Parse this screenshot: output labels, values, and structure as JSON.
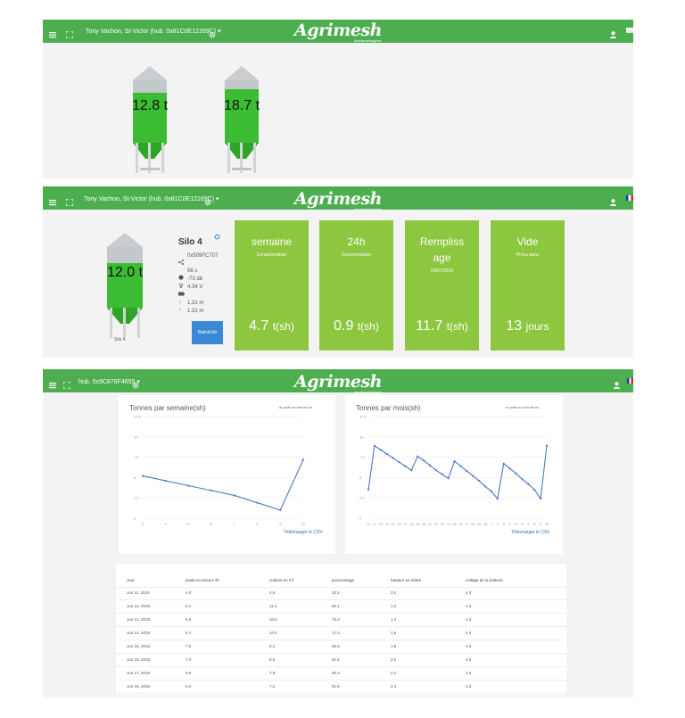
{
  "brand": {
    "logo": "Agrimesh",
    "tagline": "technologies"
  },
  "colors": {
    "green_bar": "#4cae4f",
    "card_green": "#8dc63f",
    "silo_fill": "#3cbc32",
    "button_blue": "#3b88d6"
  },
  "panel1": {
    "user": "Tony Vachon, St-Victor (hub. 0x81C0E12169C) ▾",
    "silos": [
      {
        "label": "12.8 t"
      },
      {
        "label": "18.7 t"
      }
    ]
  },
  "panel2": {
    "user": "Tony Vachon, St-Victor (hub. 0x81C0E12169C) ▾",
    "silo_value": "12.0 t",
    "silo_caption": "Silo 4",
    "silo_name": "Silo 4",
    "device_id": "0x509FC707",
    "stats": [
      "56 s",
      "-73 db",
      "4.34 V"
    ],
    "heights": [
      "1.31 m",
      "1.31 m"
    ],
    "refresh_button": "Rafraîchir",
    "cards": [
      {
        "title": "semaine",
        "subtitle": "Consommation",
        "value": "4.7",
        "unit": "t(sh)"
      },
      {
        "title": "24h",
        "subtitle": "Consommation",
        "value": "0.9",
        "unit": "t(sh)"
      },
      {
        "title": "Rempliss age",
        "subtitle": "09/07/2019",
        "value": "11.7",
        "unit": "t(sh)"
      },
      {
        "title": "Vide",
        "subtitle": "Prévu dans",
        "value": "13",
        "unit": "jours"
      }
    ]
  },
  "panel3": {
    "hub": "hub. 0x9C876F4655 ▾",
    "csv_link": "Télécharger le CSV",
    "table": {
      "headers": [
        "Jour",
        "poids en tonnes sh",
        "volume en m³",
        "pourcentage",
        "hauteur en mètre",
        "voltage de la batterie"
      ],
      "rows": [
        [
          "Jun 11, 2019",
          "4.0",
          "4.6",
          "32.2",
          "3.2",
          "4.3"
        ],
        [
          "Jun 12, 2019",
          "9.1",
          "11.2",
          "80.1",
          "1.2",
          "4.3"
        ],
        [
          "Jun 13, 2019",
          "8.6",
          "10.6",
          "75.3",
          "1.4",
          "4.3"
        ],
        [
          "Jun 14, 2019",
          "8.1",
          "10.0",
          "71.0",
          "1.6",
          "4.3"
        ],
        [
          "Jun 15, 2019",
          "7.5",
          "9.2",
          "65.5",
          "1.8",
          "4.3"
        ],
        [
          "Jun 16, 2019",
          "7.0",
          "8.6",
          "61.5",
          "2.0",
          "4.3"
        ],
        [
          "Jun 17, 2019",
          "6.5",
          "7.9",
          "56.4",
          "2.2",
          "4.3"
        ],
        [
          "Jun 18, 2019",
          "6.0",
          "7.2",
          "51.6",
          "2.4",
          "4.3"
        ]
      ]
    }
  },
  "chart_data": [
    {
      "type": "line",
      "title": "Tonnes par semaine(sh)",
      "series": [
        {
          "name": "poids en tonnes sh",
          "x": [
            3,
            4,
            5,
            6,
            7,
            8,
            9,
            10
          ],
          "values": [
            5.2,
            4.6,
            4.0,
            3.4,
            2.8,
            1.9,
            1.0,
            7.2
          ]
        }
      ],
      "xticks": [
        "3",
        "4",
        "5",
        "6",
        "7",
        "8",
        "9",
        "10"
      ],
      "yticks": [
        "0",
        "2.5",
        "5",
        "7.5",
        "10",
        "12.5"
      ],
      "xlim": [
        3,
        10
      ],
      "ylim": [
        0,
        12.5
      ],
      "grid": "horizontal",
      "legend": "top-right"
    },
    {
      "type": "line",
      "title": "Tonnes par mois(sh)",
      "series": [
        {
          "name": "poids en tonnes sh",
          "values": [
            3.5,
            8.9,
            8.4,
            7.9,
            7.4,
            6.9,
            6.4,
            5.9,
            7.6,
            7.1,
            6.5,
            5.9,
            5.4,
            4.9,
            7.0,
            6.4,
            5.8,
            5.2,
            4.6,
            3.9,
            3.3,
            2.4,
            6.7,
            6.1,
            5.5,
            4.8,
            4.2,
            3.5,
            2.4,
            8.9
          ]
        }
      ],
      "xticks": [
        "11",
        "12",
        "13",
        "14",
        "15",
        "16",
        "17",
        "18",
        "19",
        "20",
        "21",
        "22",
        "23",
        "24",
        "25",
        "26",
        "27",
        "28",
        "29",
        "30",
        "1",
        "2",
        "3",
        "4",
        "5",
        "6",
        "7",
        "8",
        "9",
        "10"
      ],
      "yticks": [
        "0",
        "2.5",
        "5",
        "7.5",
        "10",
        "12.5"
      ],
      "ylim": [
        0,
        12.5
      ],
      "grid": "horizontal",
      "legend": "top-right"
    }
  ]
}
